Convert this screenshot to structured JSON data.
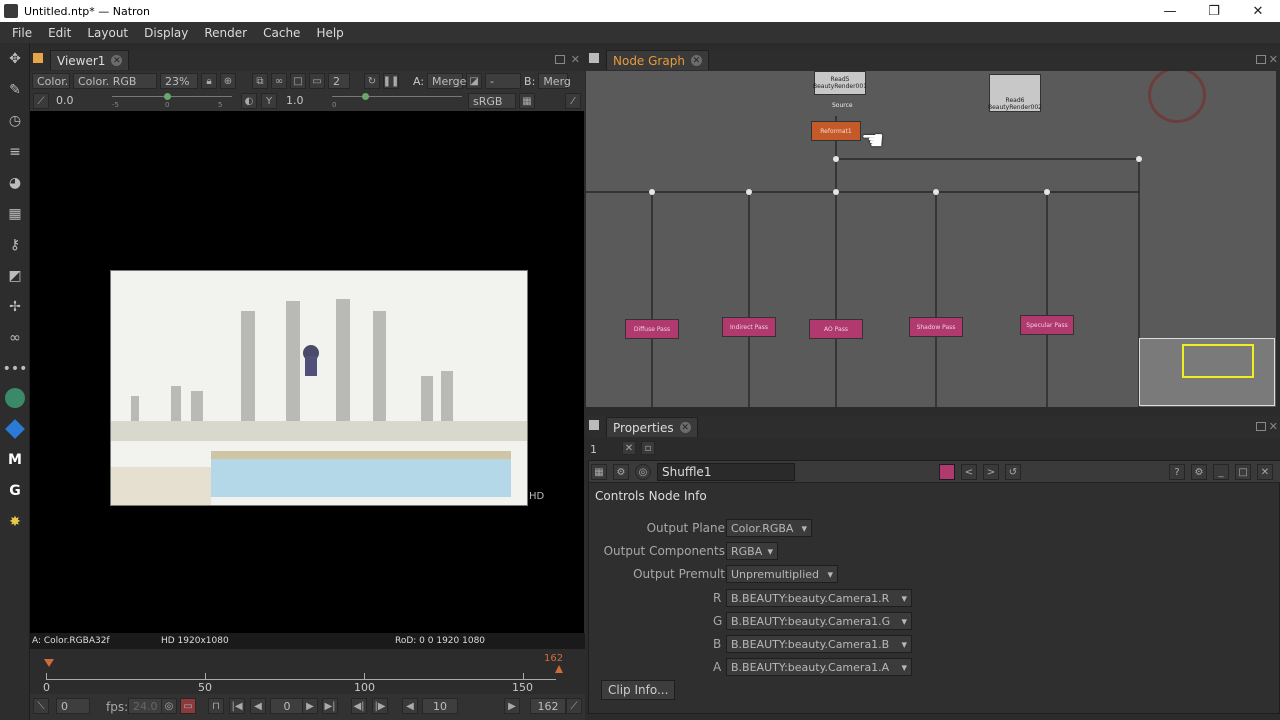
{
  "window": {
    "title": "Untitled.ntp* — Natron",
    "min": "—",
    "restore": "❐",
    "close": "✕"
  },
  "menu": [
    "File",
    "Edit",
    "Layout",
    "Display",
    "Render",
    "Cache",
    "Help"
  ],
  "viewer": {
    "tab": "Viewer1",
    "layer": "Color.",
    "channels_display": "Color. RGB",
    "zoom": "23%",
    "input_count": "2",
    "a_label": "A:",
    "a_input": "Merge",
    "a_op": "-",
    "b_label": "B:",
    "b_input": "Merg",
    "gain": "0.0",
    "gain_ticks": [
      "-5",
      "0",
      "5"
    ],
    "gamma_label": "Y",
    "gamma": "1.0",
    "gamma_ticks": [
      "0"
    ],
    "colorspace": "sRGB",
    "format_badge": "HD",
    "info_left": "A: Color.RGBA32f",
    "info_mid": "HD 1920x1080",
    "info_right": "RoD: 0 0 1920 1080"
  },
  "timeline": {
    "ticks": [
      "0",
      "50",
      "100",
      "150"
    ],
    "end_marker": "162",
    "current": "0",
    "fps_label": "fps:",
    "fps": "24.0",
    "frame": "0",
    "step": "10",
    "last": "162"
  },
  "node_graph": {
    "tab": "Node Graph",
    "nodes": {
      "read_top": "Read5",
      "read_top_sub": "BeautyRender001",
      "source_label": "Source",
      "read_right": "Read6",
      "read_right_sub": "BeautyRender002",
      "reformat": "Reformat1",
      "passes": [
        "Diffuse Pass",
        "Indirect Pass",
        "AO Pass",
        "Shadow Pass",
        "Specular Pass"
      ]
    }
  },
  "properties": {
    "tab": "Properties",
    "max_panels": "1",
    "node_name": "Shuffle1",
    "subtabs": [
      "Controls",
      "Node",
      "Info"
    ],
    "output_plane_label": "Output Plane",
    "output_plane": "Color.RGBA",
    "output_components_label": "Output Components",
    "output_components": "RGBA",
    "output_premult_label": "Output Premult",
    "output_premult": "Unpremultiplied",
    "r_label": "R",
    "r_value": "B.BEAUTY:beauty.Camera1.R",
    "g_label": "G",
    "g_value": "B.BEAUTY:beauty.Camera1.G",
    "b_label": "B",
    "b_value": "B.BEAUTY:beauty.Camera1.B",
    "a_label": "A",
    "a_value": "B.BEAUTY:beauty.Camera1.A",
    "clip_info": "Clip Info..."
  },
  "colors": {
    "pass_node": "#b03a6e",
    "reformat_node": "#c45a2a",
    "node_graph_tab": "#e89a3c"
  }
}
